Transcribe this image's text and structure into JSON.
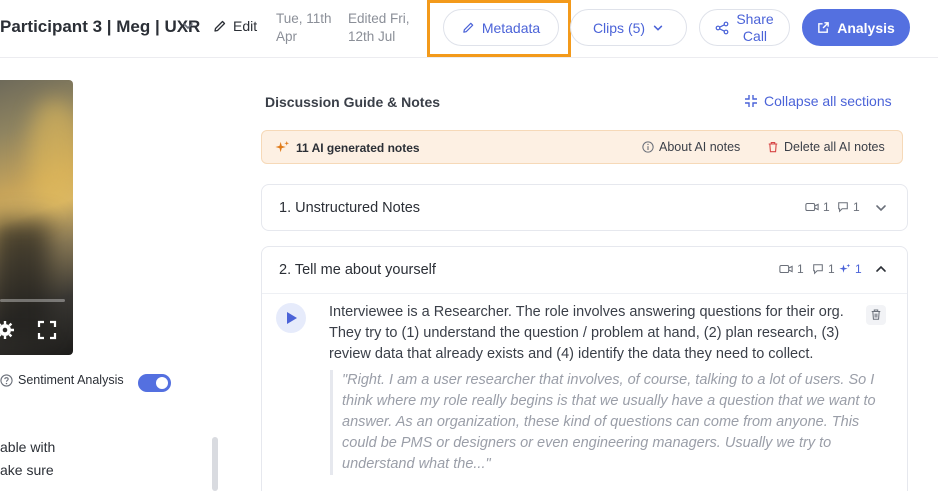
{
  "header": {
    "title": "Participant 3 | Meg | UXR",
    "edit_label": "Edit",
    "created_line1": "Tue, 11th",
    "created_line2": "Apr",
    "edited_line1": "Edited Fri,",
    "edited_line2": "12th Jul",
    "metadata_label": "Metadata",
    "clips_label": "Clips (5)",
    "share_line1": "Share",
    "share_line2": "Call",
    "analysis_label": "Analysis",
    "accent_color": "#5470e0",
    "highlight_color": "#f39a1b"
  },
  "video": {
    "icons": [
      "settings-icon",
      "fullscreen-icon"
    ]
  },
  "sentiment": {
    "label": "Sentiment Analysis",
    "enabled": true
  },
  "transcript_fragment": {
    "line1": "able with",
    "line2": "ake sure"
  },
  "guide": {
    "title": "Discussion Guide & Notes",
    "collapse_label": "Collapse all sections",
    "ai_banner": {
      "count_label": "11 AI generated notes",
      "about_label": "About AI notes",
      "delete_label": "Delete all AI notes"
    },
    "sections": [
      {
        "title": "1. Unstructured Notes",
        "clips": "1",
        "notes": "1"
      },
      {
        "title": "2.  Tell me about yourself",
        "clips": "1",
        "notes": "1",
        "ai_notes": "1",
        "summary": "Interviewee is a Researcher. The role involves answering questions for their org. They try to (1) understand the question / problem at hand, (2) plan research, (3) review data that already exists and (4) identify the data they need to collect.",
        "quote": "\"Right. I am a user researcher that involves, of course, talking to a lot of users. So I think where my role really begins is that we usually have a question that we want to answer. As an organization, these kind of questions can come from anyone. This could be PMS or designers or even engineering managers. Usually we try to understand what the...\""
      }
    ]
  }
}
